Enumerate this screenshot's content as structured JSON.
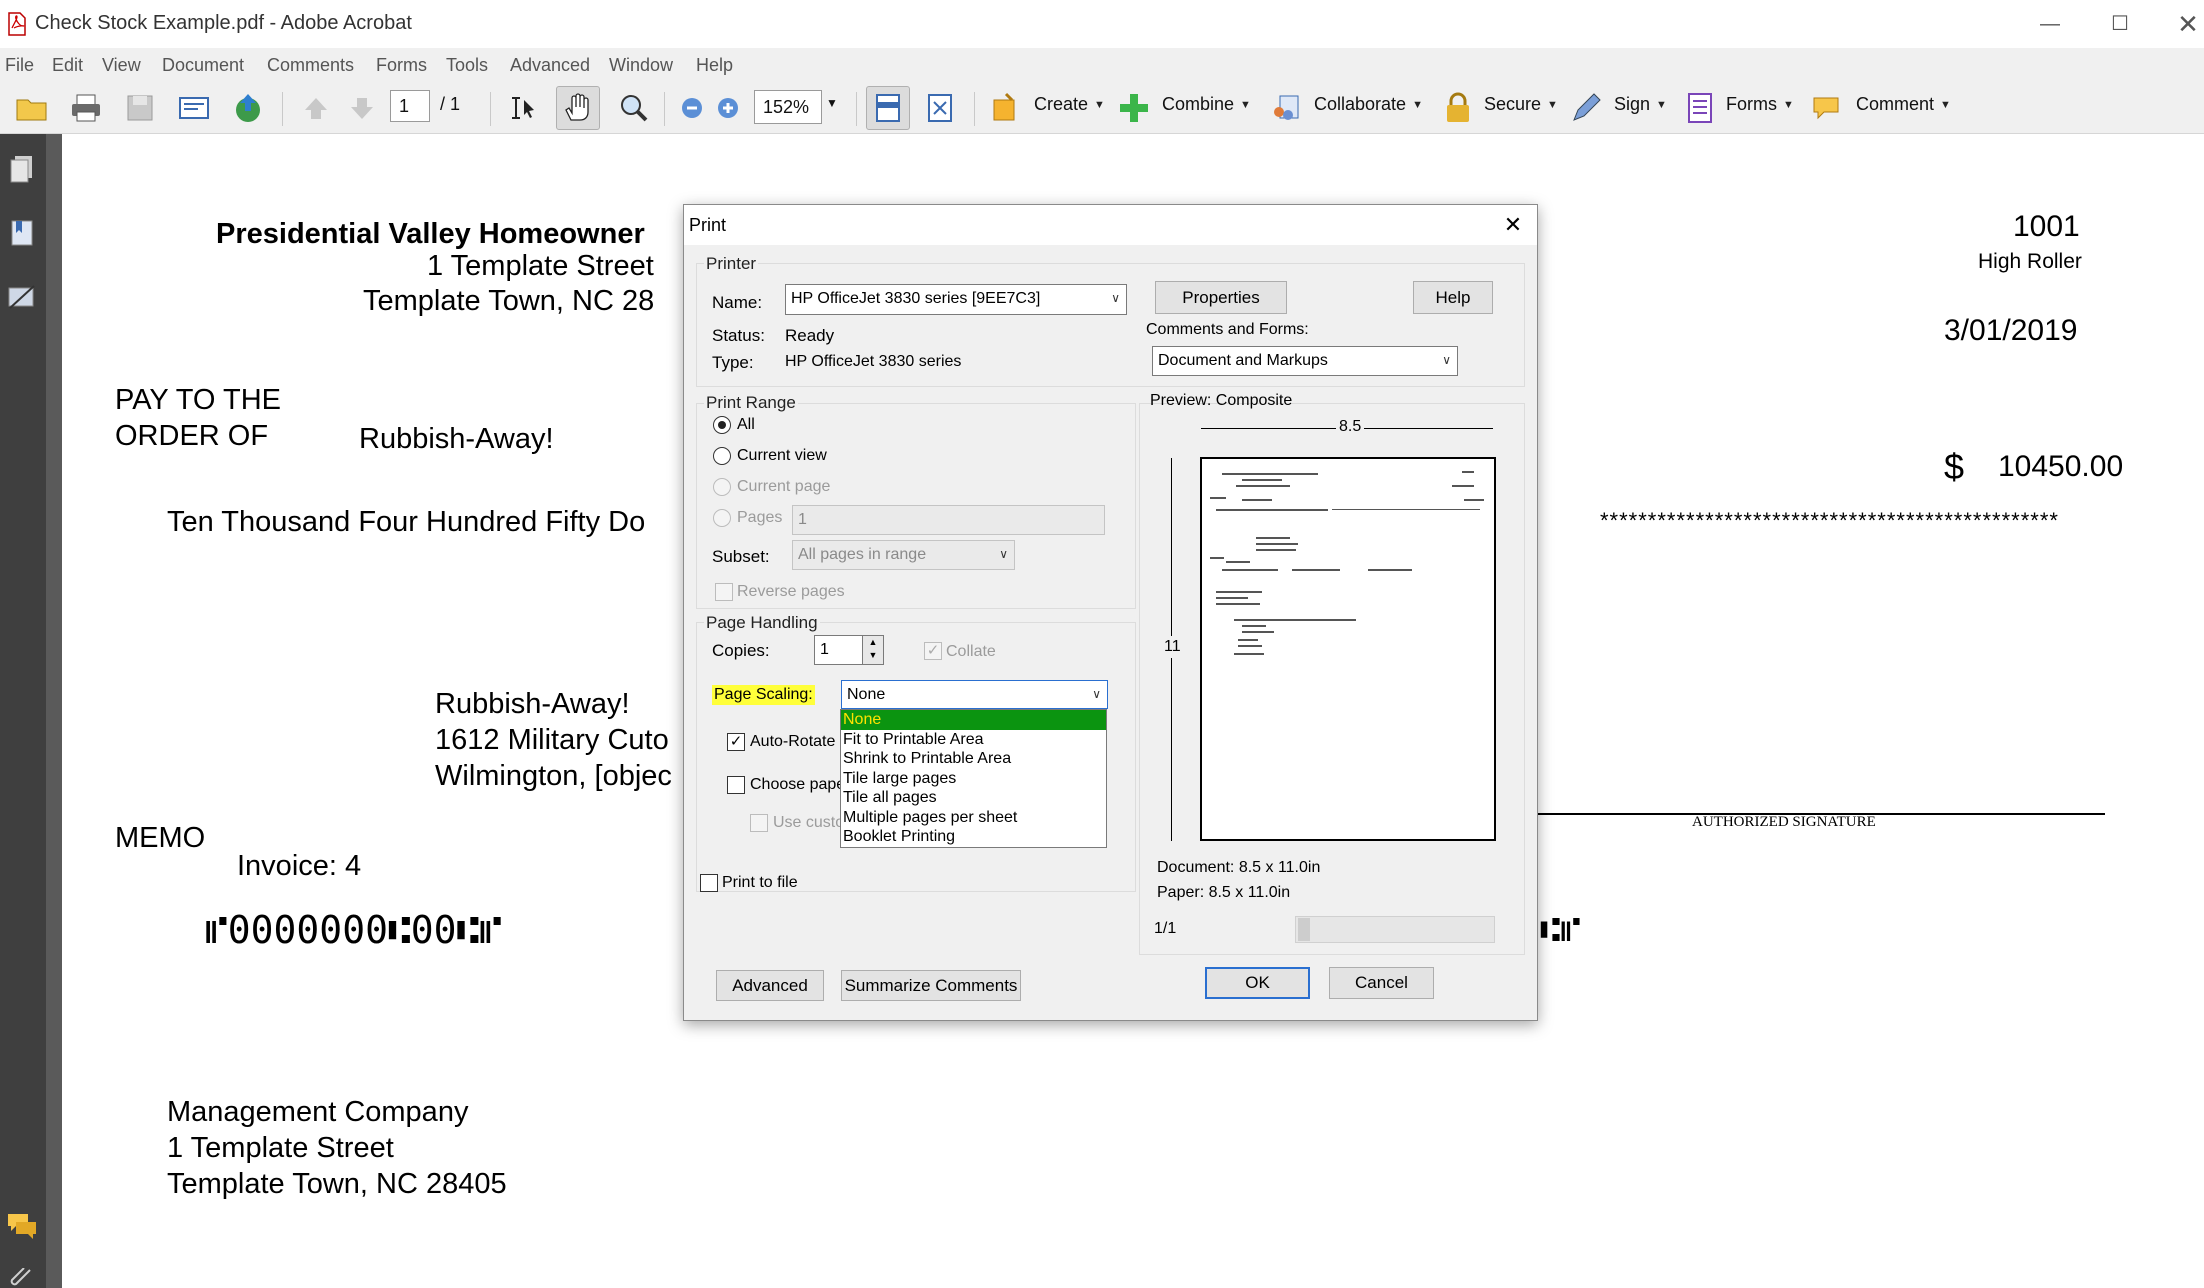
{
  "window": {
    "title": "Check Stock Example.pdf - Adobe Acrobat"
  },
  "menu": [
    "File",
    "Edit",
    "View",
    "Document",
    "Comments",
    "Forms",
    "Tools",
    "Advanced",
    "Window",
    "Help"
  ],
  "toolbar": {
    "page_current": "1",
    "page_total": "/ 1",
    "zoom": "152%",
    "create": "Create",
    "combine": "Combine",
    "collaborate": "Collaborate",
    "secure": "Secure",
    "sign": "Sign",
    "forms": "Forms",
    "comment": "Comment"
  },
  "document": {
    "org_name": "Presidential Valley Homeowner",
    "org_street": "1 Template Street",
    "org_city": "Template Town, NC 28",
    "check_number": "1001",
    "bank_label": "High Roller",
    "date": "3/01/2019",
    "pay_to_line1": "PAY TO THE",
    "pay_to_line2": "ORDER OF",
    "payee": "Rubbish-Away!",
    "dollar_sign": "$",
    "amount": "10450.00",
    "amount_words": "Ten Thousand Four Hundred Fifty Do",
    "asterisks": "************************************************",
    "payee_name": "Rubbish-Away!",
    "payee_street": "1612 Military Cuto",
    "payee_city": "Wilmington, [objec",
    "memo_label": "MEMO",
    "memo_value": "Invoice: 4",
    "micr": "⑈0000000⑆00⑆⑈",
    "micr_right": "⑆⑈",
    "signature_label": "AUTHORIZED SIGNATURE",
    "mgmt_name": "Management Company",
    "mgmt_street": "1 Template Street",
    "mgmt_city": "Template Town, NC 28405"
  },
  "print_dialog": {
    "title": "Print",
    "printer_group": "Printer",
    "name_label": "Name:",
    "printer_name": "HP OfficeJet 3830 series [9EE7C3]",
    "status_label": "Status:",
    "status_value": "Ready",
    "type_label": "Type:",
    "type_value": "HP OfficeJet 3830 series",
    "properties_button": "Properties",
    "help_button": "Help",
    "comments_forms_label": "Comments and Forms:",
    "comments_forms_value": "Document and Markups",
    "print_range_group": "Print Range",
    "range_all": "All",
    "range_current_view": "Current view",
    "range_current_page": "Current page",
    "range_pages": "Pages",
    "pages_value": "1",
    "subset_label": "Subset:",
    "subset_value": "All pages in range",
    "reverse_pages": "Reverse pages",
    "page_handling_group": "Page Handling",
    "copies_label": "Copies:",
    "copies_value": "1",
    "collate": "Collate",
    "page_scaling_label": "Page Scaling:",
    "page_scaling_value": "None",
    "scaling_options": [
      "None",
      "Fit to Printable Area",
      "Shrink to Printable Area",
      "Tile large pages",
      "Tile all pages",
      "Multiple pages per sheet",
      "Booklet Printing"
    ],
    "auto_rotate": "Auto-Rotate",
    "choose_paper": "Choose pape",
    "use_custom": "Use custo",
    "print_to_file": "Print to file",
    "preview_label": "Preview: Composite",
    "preview_width": "8.5",
    "preview_height": "11",
    "document_size": "Document: 8.5 x 11.0in",
    "paper_size": "Paper: 8.5 x 11.0in",
    "page_counter": "1/1",
    "advanced_button": "Advanced",
    "summarize_button": "Summarize Comments",
    "ok_button": "OK",
    "cancel_button": "Cancel"
  },
  "colors": {
    "highlight_label": "#ffff3a",
    "selected_option_bg": "#0b9410",
    "selected_option_text": "#ffe200",
    "default_button_border": "#2a6fd0"
  }
}
